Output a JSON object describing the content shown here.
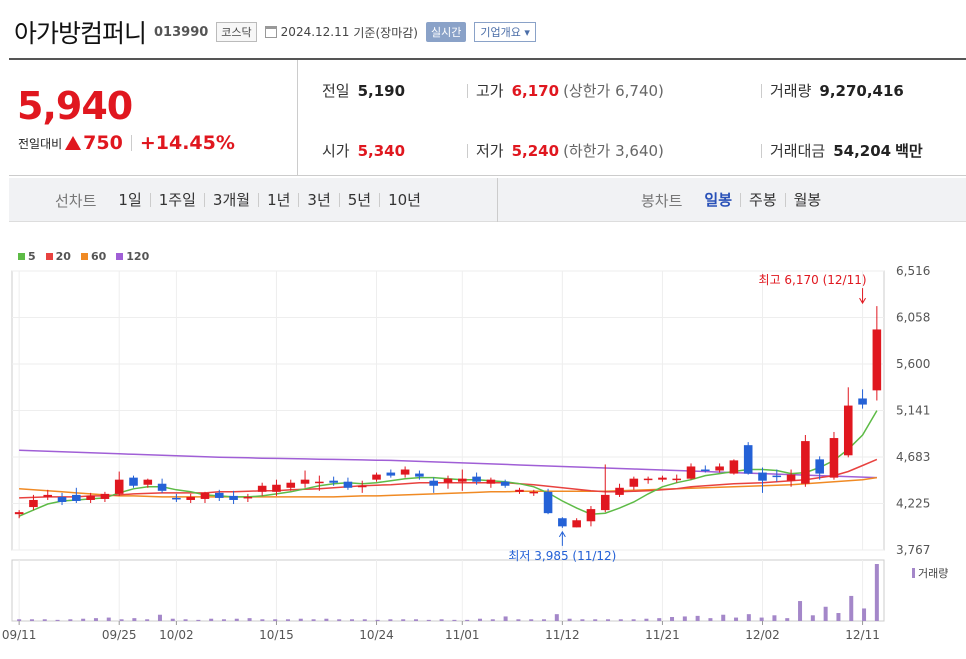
{
  "header": {
    "name": "아가방컴퍼니",
    "code": "013990",
    "market": "코스닥",
    "date": "2024.12.11",
    "date_suffix": "기준(장마감)",
    "realtime": "실시간",
    "corp_info": "기업개요 ▾"
  },
  "price": {
    "current": "5,940",
    "change_label": "전일대비",
    "change": "750",
    "change_pct": "+14.45%"
  },
  "stats": {
    "prev_label": "전일",
    "prev": "5,190",
    "high_label": "고가",
    "high": "6,170",
    "upper": "(상한가 6,740)",
    "volume_label": "거래량",
    "volume": "9,270,416",
    "open_label": "시가",
    "open": "5,340",
    "low_label": "저가",
    "low": "5,240",
    "lower": "(하한가 3,640)",
    "amount_label": "거래대금",
    "amount": "54,204",
    "amount_unit": "백만"
  },
  "tabs": {
    "line_label": "선차트",
    "line": [
      "1일",
      "1주일",
      "3개월",
      "1년",
      "3년",
      "5년",
      "10년"
    ],
    "candle_label": "봉차트",
    "candle": [
      "일봉",
      "주봉",
      "월봉"
    ],
    "active_candle": "일봉"
  },
  "colors": {
    "up": "#e0171f",
    "down": "#2461d6",
    "ma5": "#5dbb46",
    "ma20": "#e8423f",
    "ma60": "#f08a24",
    "ma120": "#a05fd6",
    "volume": "#a487c9"
  },
  "chart_data": {
    "type": "candlestick",
    "legend": [
      {
        "name": "5",
        "color": "#5dbb46"
      },
      {
        "name": "20",
        "color": "#e8423f"
      },
      {
        "name": "60",
        "color": "#f08a24"
      },
      {
        "name": "120",
        "color": "#a05fd6"
      }
    ],
    "ylim": [
      3767,
      6516
    ],
    "yticks": [
      "6,516",
      "6,058",
      "5,600",
      "5,141",
      "4,683",
      "4,225",
      "3,767"
    ],
    "ytick_values": [
      6516,
      6058,
      5600,
      5141,
      4683,
      4225,
      3767
    ],
    "xticks": [
      {
        "label": "09/11",
        "index": 0
      },
      {
        "label": "09/25",
        "index": 7
      },
      {
        "label": "10/02",
        "index": 11
      },
      {
        "label": "10/15",
        "index": 18
      },
      {
        "label": "10/24",
        "index": 25
      },
      {
        "label": "11/01",
        "index": 31
      },
      {
        "label": "11/12",
        "index": 38
      },
      {
        "label": "11/21",
        "index": 45
      },
      {
        "label": "12/02",
        "index": 52
      },
      {
        "label": "12/11",
        "index": 59
      }
    ],
    "annotations": {
      "max_label": "최고 6,170 (12/11)",
      "max_index": 59,
      "max_value": 6170,
      "min_label": "최저 3,985 (11/12)",
      "min_index": 38,
      "min_value": 3985
    },
    "volume_label": "거래량",
    "candles": [
      {
        "o": 4120,
        "h": 4160,
        "l": 4080,
        "c": 4140
      },
      {
        "o": 4190,
        "h": 4310,
        "l": 4160,
        "c": 4260
      },
      {
        "o": 4290,
        "h": 4360,
        "l": 4260,
        "c": 4310
      },
      {
        "o": 4290,
        "h": 4330,
        "l": 4210,
        "c": 4240
      },
      {
        "o": 4310,
        "h": 4380,
        "l": 4230,
        "c": 4250
      },
      {
        "o": 4260,
        "h": 4330,
        "l": 4230,
        "c": 4300
      },
      {
        "o": 4270,
        "h": 4340,
        "l": 4240,
        "c": 4320
      },
      {
        "o": 4320,
        "h": 4540,
        "l": 4300,
        "c": 4460
      },
      {
        "o": 4480,
        "h": 4500,
        "l": 4380,
        "c": 4400
      },
      {
        "o": 4410,
        "h": 4470,
        "l": 4380,
        "c": 4460
      },
      {
        "o": 4420,
        "h": 4470,
        "l": 4330,
        "c": 4350
      },
      {
        "o": 4280,
        "h": 4320,
        "l": 4240,
        "c": 4270
      },
      {
        "o": 4260,
        "h": 4320,
        "l": 4230,
        "c": 4290
      },
      {
        "o": 4270,
        "h": 4340,
        "l": 4230,
        "c": 4330
      },
      {
        "o": 4330,
        "h": 4360,
        "l": 4250,
        "c": 4280
      },
      {
        "o": 4300,
        "h": 4350,
        "l": 4220,
        "c": 4260
      },
      {
        "o": 4280,
        "h": 4320,
        "l": 4240,
        "c": 4290
      },
      {
        "o": 4340,
        "h": 4430,
        "l": 4300,
        "c": 4400
      },
      {
        "o": 4340,
        "h": 4460,
        "l": 4300,
        "c": 4410
      },
      {
        "o": 4380,
        "h": 4460,
        "l": 4350,
        "c": 4430
      },
      {
        "o": 4420,
        "h": 4550,
        "l": 4380,
        "c": 4460
      },
      {
        "o": 4440,
        "h": 4500,
        "l": 4350,
        "c": 4440
      },
      {
        "o": 4450,
        "h": 4490,
        "l": 4400,
        "c": 4430
      },
      {
        "o": 4440,
        "h": 4480,
        "l": 4360,
        "c": 4380
      },
      {
        "o": 4390,
        "h": 4450,
        "l": 4330,
        "c": 4400
      },
      {
        "o": 4460,
        "h": 4530,
        "l": 4440,
        "c": 4510
      },
      {
        "o": 4530,
        "h": 4560,
        "l": 4480,
        "c": 4500
      },
      {
        "o": 4510,
        "h": 4590,
        "l": 4480,
        "c": 4560
      },
      {
        "o": 4520,
        "h": 4550,
        "l": 4460,
        "c": 4490
      },
      {
        "o": 4450,
        "h": 4480,
        "l": 4330,
        "c": 4400
      },
      {
        "o": 4430,
        "h": 4500,
        "l": 4370,
        "c": 4470
      },
      {
        "o": 4440,
        "h": 4560,
        "l": 4350,
        "c": 4470
      },
      {
        "o": 4490,
        "h": 4530,
        "l": 4410,
        "c": 4440
      },
      {
        "o": 4420,
        "h": 4480,
        "l": 4380,
        "c": 4460
      },
      {
        "o": 4440,
        "h": 4460,
        "l": 4380,
        "c": 4400
      },
      {
        "o": 4340,
        "h": 4380,
        "l": 4320,
        "c": 4360
      },
      {
        "o": 4330,
        "h": 4360,
        "l": 4300,
        "c": 4340
      },
      {
        "o": 4340,
        "h": 4370,
        "l": 4120,
        "c": 4130
      },
      {
        "o": 4080,
        "h": 4090,
        "l": 3985,
        "c": 4000
      },
      {
        "o": 3990,
        "h": 4080,
        "l": 3990,
        "c": 4060
      },
      {
        "o": 4050,
        "h": 4200,
        "l": 4000,
        "c": 4170
      },
      {
        "o": 4160,
        "h": 4610,
        "l": 4140,
        "c": 4310
      },
      {
        "o": 4310,
        "h": 4420,
        "l": 4290,
        "c": 4380
      },
      {
        "o": 4390,
        "h": 4490,
        "l": 4360,
        "c": 4470
      },
      {
        "o": 4460,
        "h": 4490,
        "l": 4420,
        "c": 4470
      },
      {
        "o": 4460,
        "h": 4500,
        "l": 4440,
        "c": 4480
      },
      {
        "o": 4470,
        "h": 4510,
        "l": 4430,
        "c": 4470
      },
      {
        "o": 4470,
        "h": 4620,
        "l": 4460,
        "c": 4590
      },
      {
        "o": 4560,
        "h": 4600,
        "l": 4530,
        "c": 4550
      },
      {
        "o": 4550,
        "h": 4620,
        "l": 4530,
        "c": 4590
      },
      {
        "o": 4520,
        "h": 4660,
        "l": 4510,
        "c": 4650
      },
      {
        "o": 4800,
        "h": 4830,
        "l": 4510,
        "c": 4520
      },
      {
        "o": 4530,
        "h": 4580,
        "l": 4330,
        "c": 4450
      },
      {
        "o": 4500,
        "h": 4560,
        "l": 4440,
        "c": 4490
      },
      {
        "o": 4450,
        "h": 4560,
        "l": 4390,
        "c": 4510
      },
      {
        "o": 4420,
        "h": 4900,
        "l": 4390,
        "c": 4840
      },
      {
        "o": 4660,
        "h": 4690,
        "l": 4460,
        "c": 4520
      },
      {
        "o": 4480,
        "h": 4930,
        "l": 4460,
        "c": 4870
      },
      {
        "o": 4700,
        "h": 5370,
        "l": 4680,
        "c": 5190
      },
      {
        "o": 5260,
        "h": 5350,
        "l": 5160,
        "c": 5200
      },
      {
        "o": 5340,
        "h": 6170,
        "l": 5240,
        "c": 5940
      }
    ],
    "volumes": [
      0.03,
      0.03,
      0.03,
      0.02,
      0.03,
      0.04,
      0.05,
      0.06,
      0.03,
      0.05,
      0.03,
      0.11,
      0.04,
      0.03,
      0.02,
      0.04,
      0.03,
      0.04,
      0.05,
      0.03,
      0.03,
      0.03,
      0.04,
      0.03,
      0.04,
      0.03,
      0.03,
      0.03,
      0.02,
      0.03,
      0.03,
      0.03,
      0.02,
      0.03,
      0.02,
      0.02,
      0.04,
      0.03,
      0.08,
      0.03,
      0.03,
      0.03,
      0.12,
      0.04,
      0.03,
      0.03,
      0.03,
      0.03,
      0.03,
      0.04,
      0.05,
      0.07,
      0.08,
      0.09,
      0.05,
      0.11,
      0.06,
      0.12,
      0.06,
      0.1,
      0.05,
      0.35,
      0.1,
      0.25,
      0.14,
      0.44,
      0.22,
      1.0
    ],
    "ma5": [
      4100,
      4160,
      4220,
      4250,
      4260,
      4270,
      4280,
      4330,
      4370,
      4390,
      4390,
      4360,
      4340,
      4310,
      4300,
      4290,
      4290,
      4300,
      4320,
      4340,
      4370,
      4400,
      4420,
      4430,
      4420,
      4430,
      4450,
      4470,
      4480,
      4480,
      4470,
      4460,
      4460,
      4450,
      4440,
      4420,
      4390,
      4330,
      4250,
      4180,
      4120,
      4130,
      4180,
      4240,
      4320,
      4390,
      4430,
      4460,
      4500,
      4520,
      4540,
      4560,
      4560,
      4550,
      4520,
      4530,
      4580,
      4650,
      4760,
      4900,
      5141
    ],
    "ma20": [
      4280,
      4285,
      4290,
      4290,
      4290,
      4300,
      4300,
      4310,
      4320,
      4325,
      4330,
      4330,
      4330,
      4330,
      4340,
      4340,
      4345,
      4350,
      4350,
      4360,
      4365,
      4370,
      4380,
      4390,
      4400,
      4405,
      4410,
      4420,
      4430,
      4430,
      4430,
      4430,
      4430,
      4430,
      4430,
      4420,
      4410,
      4395,
      4380,
      4365,
      4350,
      4340,
      4340,
      4345,
      4350,
      4360,
      4370,
      4390,
      4400,
      4410,
      4420,
      4425,
      4430,
      4440,
      4450,
      4460,
      4480,
      4500,
      4540,
      4600,
      4660
    ],
    "ma60": [
      4370,
      4360,
      4350,
      4340,
      4330,
      4320,
      4310,
      4300,
      4300,
      4295,
      4290,
      4290,
      4290,
      4290,
      4290,
      4290,
      4290,
      4290,
      4290,
      4290,
      4290,
      4290,
      4290,
      4295,
      4300,
      4300,
      4305,
      4310,
      4315,
      4320,
      4325,
      4330,
      4335,
      4340,
      4340,
      4345,
      4345,
      4345,
      4345,
      4345,
      4345,
      4345,
      4350,
      4355,
      4360,
      4365,
      4370,
      4375,
      4380,
      4385,
      4390,
      4395,
      4400,
      4405,
      4410,
      4420,
      4430,
      4440,
      4450,
      4460,
      4480
    ],
    "ma120": [
      4750,
      4745,
      4740,
      4735,
      4730,
      4725,
      4720,
      4715,
      4710,
      4705,
      4700,
      4695,
      4690,
      4685,
      4680,
      4678,
      4675,
      4672,
      4670,
      4668,
      4665,
      4662,
      4660,
      4658,
      4655,
      4652,
      4650,
      4645,
      4640,
      4635,
      4630,
      4625,
      4620,
      4615,
      4610,
      4605,
      4600,
      4595,
      4590,
      4585,
      4580,
      4575,
      4570,
      4565,
      4560,
      4555,
      4550,
      4545,
      4540,
      4535,
      4530,
      4525,
      4520,
      4515,
      4510,
      4505,
      4500,
      4495,
      4490,
      4485,
      4480
    ]
  }
}
